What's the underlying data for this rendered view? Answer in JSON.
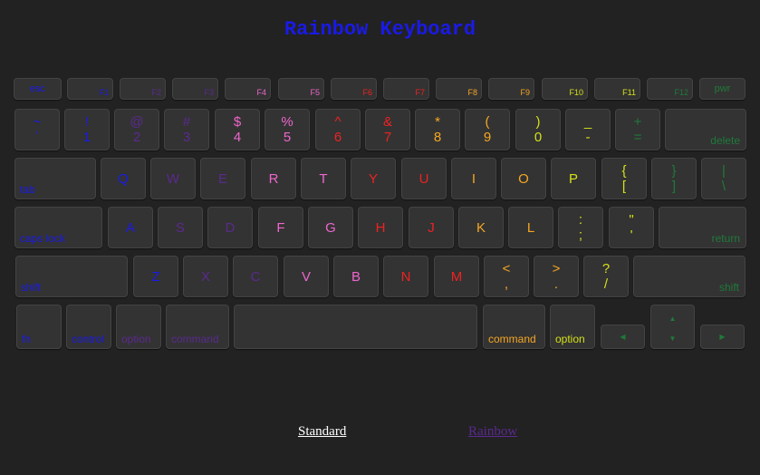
{
  "title": "Rainbow Keyboard",
  "colors": {
    "background": "#222222",
    "key_background": "#333333",
    "blue": "#1a1ae6",
    "purple": "#5a2a8e",
    "pink": "#ee66cc",
    "red": "#ee2222",
    "orange": "#f5a623",
    "yellow": "#d4e01a",
    "green": "#1f7a3a"
  },
  "keyboard": {
    "row_fn": [
      "esc",
      "F1",
      "F2",
      "F3",
      "F4",
      "F5",
      "F6",
      "F7",
      "F8",
      "F9",
      "F10",
      "F11",
      "F12",
      "pwr"
    ],
    "row_num": [
      {
        "top": "~",
        "bottom": "`"
      },
      {
        "top": "!",
        "bottom": "1"
      },
      {
        "top": "@",
        "bottom": "2"
      },
      {
        "top": "#",
        "bottom": "3"
      },
      {
        "top": "$",
        "bottom": "4"
      },
      {
        "top": "%",
        "bottom": "5"
      },
      {
        "top": "^",
        "bottom": "6"
      },
      {
        "top": "&",
        "bottom": "7"
      },
      {
        "top": "*",
        "bottom": "8"
      },
      {
        "top": "(",
        "bottom": "9"
      },
      {
        "top": ")",
        "bottom": "0"
      },
      {
        "top": "_",
        "bottom": "-"
      },
      {
        "top": "+",
        "bottom": "="
      },
      {
        "label": "delete"
      }
    ],
    "row_q": [
      {
        "label": "tab"
      },
      {
        "label": "Q"
      },
      {
        "label": "W"
      },
      {
        "label": "E"
      },
      {
        "label": "R"
      },
      {
        "label": "T"
      },
      {
        "label": "Y"
      },
      {
        "label": "U"
      },
      {
        "label": "I"
      },
      {
        "label": "O"
      },
      {
        "label": "P"
      },
      {
        "top": "{",
        "bottom": "["
      },
      {
        "top": "}",
        "bottom": "]"
      },
      {
        "top": "|",
        "bottom": "\\"
      }
    ],
    "row_a": [
      {
        "label": "caps lock"
      },
      {
        "label": "A"
      },
      {
        "label": "S"
      },
      {
        "label": "D"
      },
      {
        "label": "F"
      },
      {
        "label": "G"
      },
      {
        "label": "H"
      },
      {
        "label": "J"
      },
      {
        "label": "K"
      },
      {
        "label": "L"
      },
      {
        "top": ":",
        "bottom": ";"
      },
      {
        "top": "\"",
        "bottom": "'"
      },
      {
        "label": "return"
      }
    ],
    "row_z": [
      {
        "label": "shift"
      },
      {
        "label": "Z"
      },
      {
        "label": "X"
      },
      {
        "label": "C"
      },
      {
        "label": "V"
      },
      {
        "label": "B"
      },
      {
        "label": "N"
      },
      {
        "label": "M"
      },
      {
        "top": "<",
        "bottom": ","
      },
      {
        "top": ">",
        "bottom": "."
      },
      {
        "top": "?",
        "bottom": "/"
      },
      {
        "label": "shift"
      }
    ],
    "row_bottom": [
      {
        "label": "fn"
      },
      {
        "label": "control"
      },
      {
        "label": "option"
      },
      {
        "label": "command"
      },
      {
        "label": ""
      },
      {
        "label": "command"
      },
      {
        "label": "option"
      }
    ],
    "arrows": {
      "left": "◀",
      "up": "▲",
      "down": "▼",
      "right": "▶"
    }
  },
  "links": {
    "standard": "Standard",
    "rainbow": "Rainbow"
  }
}
